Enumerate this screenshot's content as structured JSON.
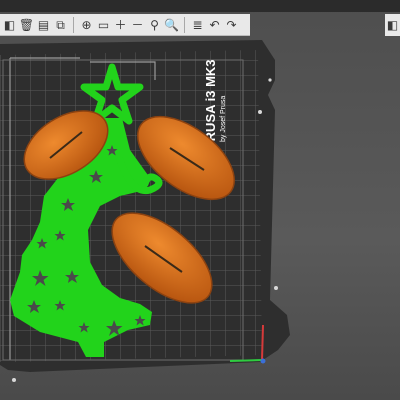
{
  "toolbar": {
    "buttons": [
      {
        "icon": "cube-icon",
        "glyph": "◧"
      },
      {
        "icon": "delete-icon",
        "glyph": "🗑"
      },
      {
        "icon": "delete-all-icon",
        "glyph": "▤"
      },
      {
        "icon": "arrange-icon",
        "glyph": "⧉"
      },
      {
        "icon": "copy-icon",
        "glyph": "⊕"
      },
      {
        "icon": "paste-icon",
        "glyph": "▭"
      },
      {
        "icon": "add-instance-icon",
        "glyph": "＋"
      },
      {
        "icon": "remove-instance-icon",
        "glyph": "－"
      },
      {
        "icon": "split-objects-icon",
        "glyph": "⚲"
      },
      {
        "icon": "search-icon",
        "glyph": "🔍"
      },
      {
        "icon": "layers-icon",
        "glyph": "≣"
      },
      {
        "icon": "undo-icon",
        "glyph": "↶"
      },
      {
        "icon": "redo-icon",
        "glyph": "↷"
      }
    ],
    "right_tool_glyph": "◧"
  },
  "bed": {
    "brand_line1": "PRUSA i3 MK3",
    "brand_line2": "by Josef Prusa"
  },
  "colors": {
    "tree": "#22d31b",
    "ornaments": "#d2691e",
    "bed": "#2e2e2e",
    "grid": "#5c5c5c"
  }
}
